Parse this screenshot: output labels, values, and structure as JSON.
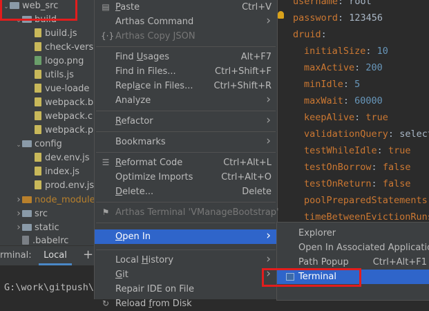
{
  "project_tree": {
    "items": [
      {
        "label": "web_src",
        "type": "folder",
        "expanded": true,
        "indent": 0
      },
      {
        "label": "build",
        "type": "folder",
        "expanded": true,
        "indent": 1
      },
      {
        "label": "build.js",
        "type": "js",
        "indent": 2
      },
      {
        "label": "check-vers",
        "type": "js",
        "indent": 2
      },
      {
        "label": "logo.png",
        "type": "png",
        "indent": 2
      },
      {
        "label": "utils.js",
        "type": "js",
        "indent": 2
      },
      {
        "label": "vue-loade",
        "type": "js",
        "indent": 2
      },
      {
        "label": "webpack.b",
        "type": "js",
        "indent": 2
      },
      {
        "label": "webpack.c",
        "type": "js",
        "indent": 2
      },
      {
        "label": "webpack.p",
        "type": "js",
        "indent": 2
      },
      {
        "label": "config",
        "type": "folder",
        "expanded": true,
        "indent": 1
      },
      {
        "label": "dev.env.js",
        "type": "js",
        "indent": 2
      },
      {
        "label": "index.js",
        "type": "js",
        "indent": 2
      },
      {
        "label": "prod.env.js",
        "type": "js",
        "indent": 2
      },
      {
        "label": "node_module",
        "type": "folder-orange",
        "expanded": false,
        "indent": 1
      },
      {
        "label": "src",
        "type": "folder",
        "expanded": false,
        "indent": 1
      },
      {
        "label": "static",
        "type": "folder",
        "expanded": false,
        "indent": 1
      },
      {
        "label": ".babelrc",
        "type": "babel",
        "indent": 1
      }
    ]
  },
  "terminal": {
    "title": "rminal:",
    "tab_label": "Local",
    "add_symbol": "+",
    "prompt": "G:\\work\\gitpush\\"
  },
  "context_menu": {
    "items": [
      {
        "label": "Paste",
        "u": "P",
        "shortcut": "Ctrl+V",
        "icon": "paste-icon",
        "glyph": "▤"
      },
      {
        "label": "Arthas Command",
        "submenu": true
      },
      {
        "label": "Arthas Copy JSON",
        "disabled": true,
        "icon": "json-icon",
        "glyph": "{·}"
      },
      {
        "separator": true
      },
      {
        "label": "Find Usages",
        "shortcut": "Alt+F7"
      },
      {
        "label": "Find in Files...",
        "shortcut": "Ctrl+Shift+F"
      },
      {
        "label": "Replace in Files...",
        "shortcut": "Ctrl+Shift+R"
      },
      {
        "label": "Analyze",
        "submenu": true
      },
      {
        "separator": true
      },
      {
        "label": "Refactor",
        "submenu": true
      },
      {
        "separator": true
      },
      {
        "label": "Bookmarks",
        "submenu": true
      },
      {
        "separator": true
      },
      {
        "label": "Reformat Code",
        "shortcut": "Ctrl+Alt+L",
        "icon": "reformat-icon",
        "glyph": "☰"
      },
      {
        "label": "Optimize Imports",
        "shortcut": "Ctrl+Alt+O"
      },
      {
        "label": "Delete...",
        "shortcut": "Delete"
      },
      {
        "separator": true
      },
      {
        "label": "Arthas Terminal 'VManageBootstrap'",
        "disabled": true,
        "icon": "arthas-icon",
        "glyph": "⚑"
      },
      {
        "separator": true
      },
      {
        "label": "Open In",
        "submenu": true,
        "highlighted": true
      },
      {
        "separator": true
      },
      {
        "label": "Local History",
        "submenu": true
      },
      {
        "label": "Git",
        "submenu": true
      },
      {
        "label": "Repair IDE on File"
      },
      {
        "label": "Reload from Disk",
        "icon": "reload-icon",
        "glyph": "↻"
      }
    ]
  },
  "submenu": {
    "items": [
      {
        "label": "Explorer"
      },
      {
        "label": "Open In Associated Application"
      },
      {
        "label": "Path Popup",
        "shortcut": "Ctrl+Alt+F1"
      },
      {
        "label": "Terminal",
        "highlighted": true,
        "icon": "terminal-icon"
      }
    ]
  },
  "editor": {
    "lines": [
      {
        "key": "username",
        "val": "root",
        "indent": 1
      },
      {
        "key": "password",
        "val": "123456",
        "indent": 1
      },
      {
        "key": "druid",
        "val": "",
        "indent": 1
      },
      {
        "key": "initialSize",
        "val": "10",
        "indent": 2,
        "num": true
      },
      {
        "key": "maxActive",
        "val": "200",
        "indent": 2,
        "num": true
      },
      {
        "key": "minIdle",
        "val": "5",
        "indent": 2,
        "num": true
      },
      {
        "key": "maxWait",
        "val": "60000",
        "indent": 2,
        "num": true
      },
      {
        "key": "keepAlive",
        "val": "true",
        "indent": 2,
        "kw": true
      },
      {
        "key": "validationQuery",
        "val": "select",
        "indent": 2
      },
      {
        "key": "testWhileIdle",
        "val": "true",
        "indent": 2,
        "kw": true
      },
      {
        "key": "testOnBorrow",
        "val": "false",
        "indent": 2,
        "kw": true
      },
      {
        "key": "testOnReturn",
        "val": "false",
        "indent": 2,
        "kw": true
      },
      {
        "key": "poolPreparedStatements",
        "val": "",
        "indent": 2
      },
      {
        "key": "timeBetweenEvictionRuns",
        "val": "",
        "indent": 2
      }
    ],
    "terminal_text": "build"
  },
  "colors": {
    "accent": "#2f65ca",
    "annotation": "#e21d1d"
  }
}
